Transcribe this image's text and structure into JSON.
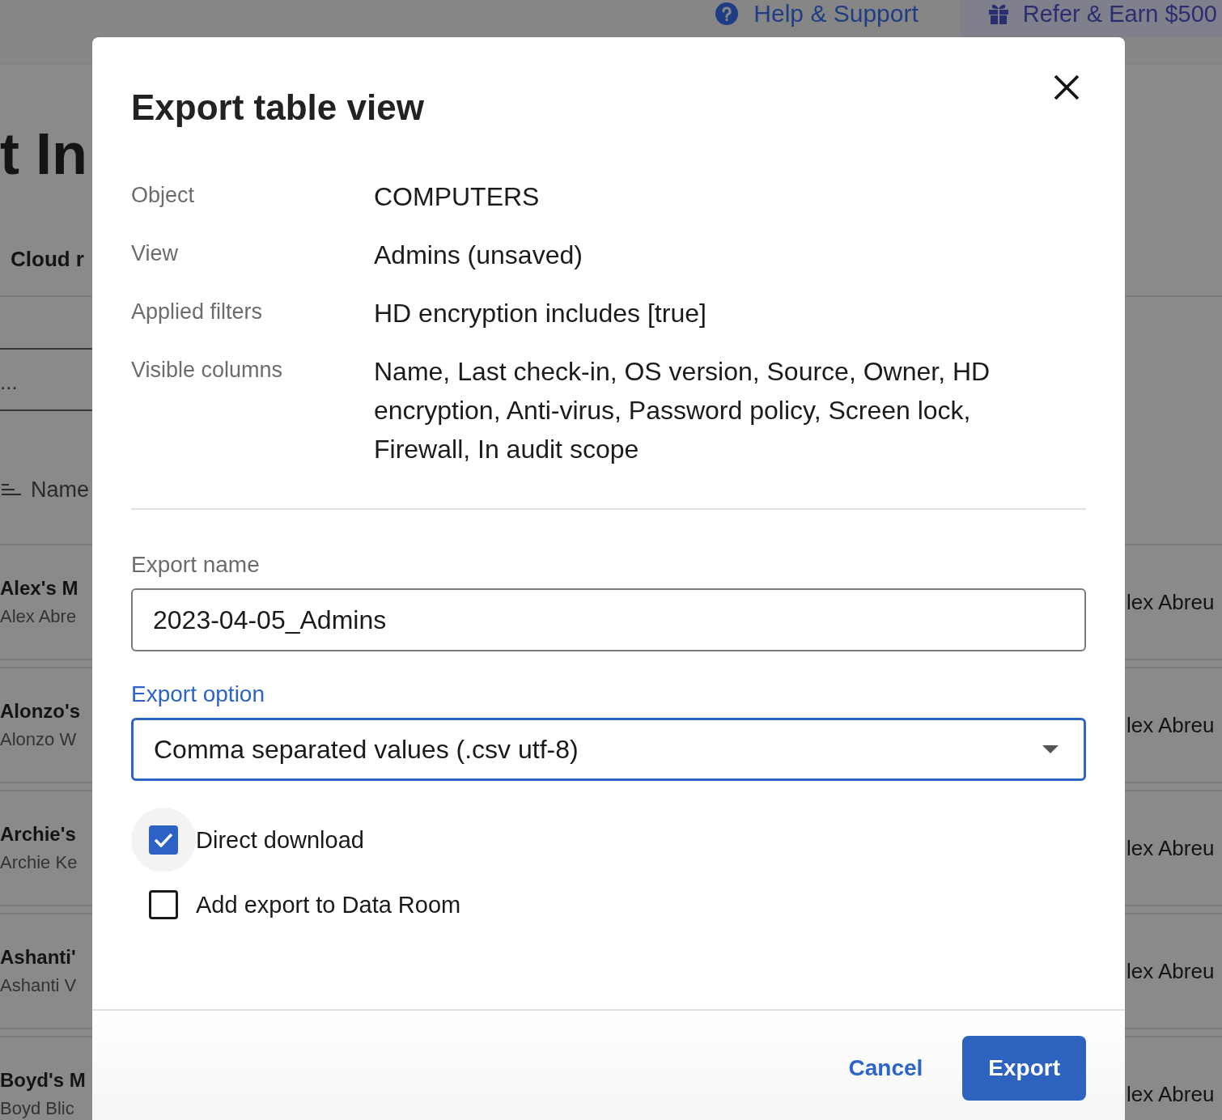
{
  "background_page": {
    "top_bar": {
      "help_link": "Help & Support",
      "referral_link": "Refer & Earn $500"
    },
    "page_title": "t In",
    "tab": "Cloud r",
    "search_field": {
      "placeholder": "..."
    },
    "column_header": "Name",
    "rows": [
      {
        "title": "Alex's M",
        "subtitle": "Alex Abre",
        "column_3": "lex Abreu"
      },
      {
        "title": "Alonzo's",
        "subtitle": "Alonzo W",
        "column_3": "lex Abreu"
      },
      {
        "title": "Archie's",
        "subtitle": "Archie Ke",
        "column_3": "lex Abreu"
      },
      {
        "title": "Ashanti'",
        "subtitle": "Ashanti V",
        "column_3": "lex Abreu"
      },
      {
        "title": "Boyd's M",
        "subtitle": "Boyd Blic",
        "column_3": "lex Abreu"
      }
    ]
  },
  "dialog": {
    "title": "Export table view",
    "details": [
      {
        "label": "Object",
        "value": "COMPUTERS"
      },
      {
        "label": "View",
        "value": "Admins (unsaved)"
      },
      {
        "label": "Applied filters",
        "value": "HD encryption includes [true]"
      },
      {
        "label": "Visible columns",
        "value": "Name, Last check-in, OS version, Source, Owner, HD encryption, Anti-virus, Password policy, Screen lock, Firewall, In audit scope"
      }
    ],
    "export_name": {
      "label": "Export name",
      "value": "2023-04-05_Admins",
      "focused": false
    },
    "export_option": {
      "label": "Export option",
      "value": "Comma separated values (.csv utf-8)",
      "focused": true
    },
    "options": [
      {
        "label": "Direct download",
        "checked": true,
        "focused": true
      },
      {
        "label": "Add export to Data Room",
        "checked": false,
        "focused": false
      }
    ],
    "buttons": [
      {
        "label": "Cancel",
        "kind": "text"
      },
      {
        "label": "Export",
        "kind": "primary"
      }
    ]
  }
}
